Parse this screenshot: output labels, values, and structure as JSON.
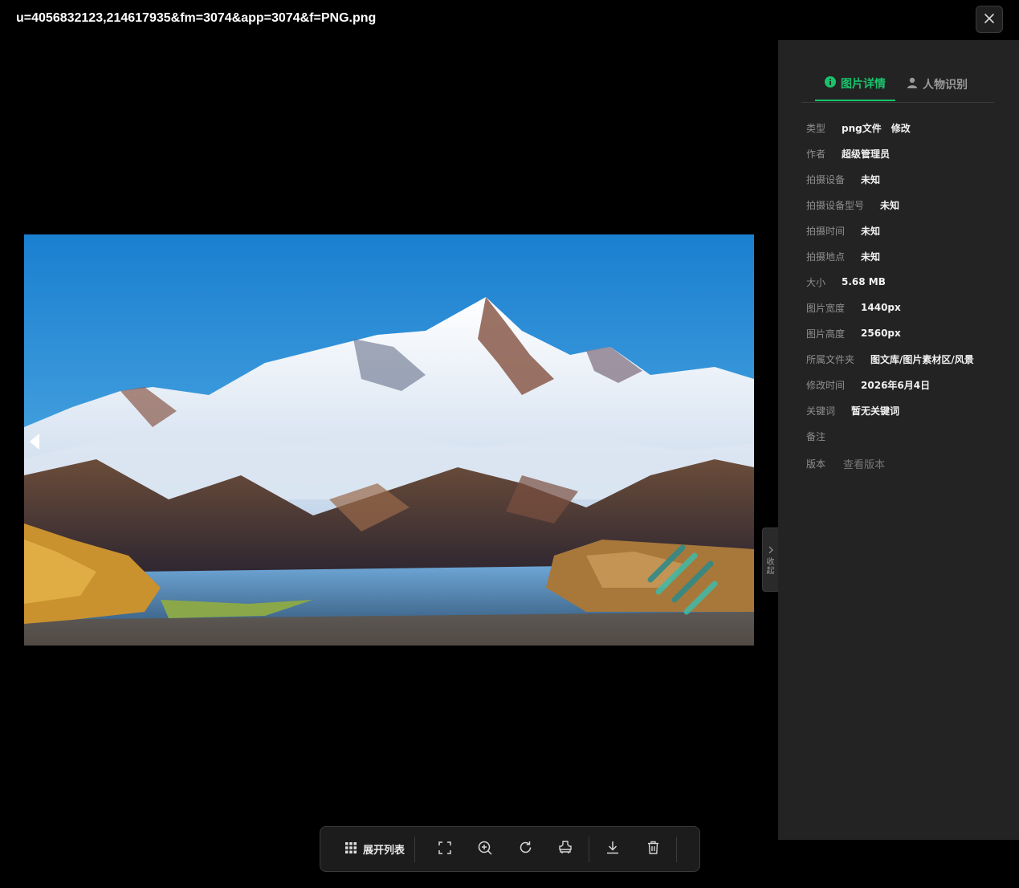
{
  "title": "u=4056832123,214617935&fm=3074&app=3074&f=PNG.png",
  "colors": {
    "accent": "#19c26b",
    "panel_bg": "#232323",
    "label": "#8f8f8f",
    "value": "#f2f2f2"
  },
  "tabs": [
    {
      "label": "图片详情",
      "icon": "info-icon",
      "active": true
    },
    {
      "label": "人物识别",
      "icon": "person-icon",
      "active": false
    }
  ],
  "info": {
    "type": {
      "label": "类型",
      "value": "png文件",
      "action": "修改"
    },
    "author": {
      "label": "作者",
      "value": "超级管理员"
    },
    "device": {
      "label": "拍摄设备",
      "value": "未知"
    },
    "model": {
      "label": "拍摄设备型号",
      "value": "未知"
    },
    "shot_time": {
      "label": "拍摄时间",
      "value": "未知"
    },
    "location": {
      "label": "拍摄地点",
      "value": "未知"
    },
    "size": {
      "label": "大小",
      "value": "5.68 MB"
    },
    "width": {
      "label": "图片宽度",
      "value": "1440px"
    },
    "height": {
      "label": "图片高度",
      "value": "2560px"
    },
    "folder": {
      "label": "所属文件夹",
      "value": "图文库/图片素材区/风景"
    },
    "modified": {
      "label": "修改时间",
      "value": "2026年6月4日"
    },
    "keywords": {
      "label": "关键词",
      "value": "暂无关键词"
    },
    "note": {
      "label": "备注",
      "value": ""
    },
    "version": {
      "label": "版本",
      "value": "查看版本"
    }
  },
  "collapse_label": "收起",
  "toolbar": {
    "expand_list": "展开列表",
    "buttons": [
      "fullscreen-icon",
      "zoom-in-icon",
      "rotate-icon",
      "stamp-icon",
      "download-icon",
      "delete-icon"
    ]
  }
}
